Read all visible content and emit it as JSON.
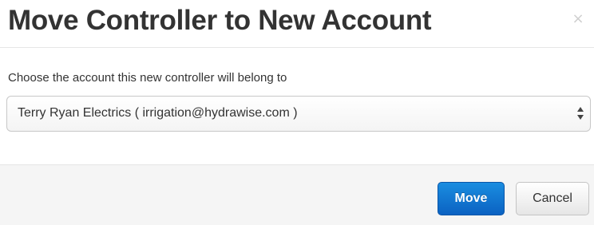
{
  "dialog": {
    "title": "Move Controller to New Account",
    "close_glyph": "×"
  },
  "form": {
    "label": "Choose the account this new controller will belong to",
    "selected_account": "Terry Ryan Electrics ( irrigation@hydrawise.com )"
  },
  "footer": {
    "move_label": "Move",
    "cancel_label": "Cancel"
  },
  "colors": {
    "primary_button": "#0b62c2",
    "title_text": "#333333",
    "footer_background": "#f5f5f5"
  },
  "icons": {
    "close": "close-icon",
    "select_arrows": "select-arrows-icon"
  }
}
